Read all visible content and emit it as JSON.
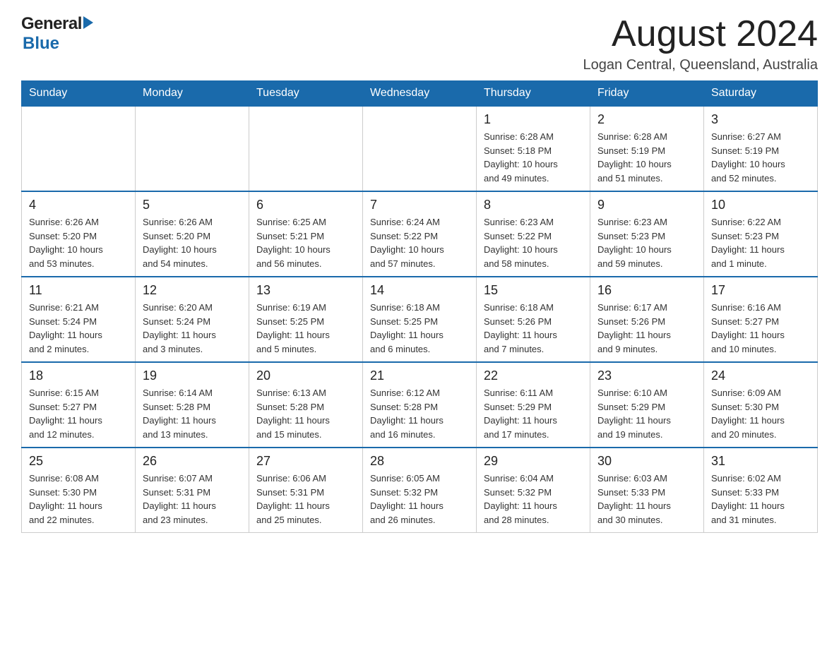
{
  "header": {
    "logo_general": "General",
    "logo_blue": "Blue",
    "month_title": "August 2024",
    "location": "Logan Central, Queensland, Australia"
  },
  "weekdays": [
    "Sunday",
    "Monday",
    "Tuesday",
    "Wednesday",
    "Thursday",
    "Friday",
    "Saturday"
  ],
  "weeks": [
    [
      {
        "day": "",
        "info": ""
      },
      {
        "day": "",
        "info": ""
      },
      {
        "day": "",
        "info": ""
      },
      {
        "day": "",
        "info": ""
      },
      {
        "day": "1",
        "info": "Sunrise: 6:28 AM\nSunset: 5:18 PM\nDaylight: 10 hours\nand 49 minutes."
      },
      {
        "day": "2",
        "info": "Sunrise: 6:28 AM\nSunset: 5:19 PM\nDaylight: 10 hours\nand 51 minutes."
      },
      {
        "day": "3",
        "info": "Sunrise: 6:27 AM\nSunset: 5:19 PM\nDaylight: 10 hours\nand 52 minutes."
      }
    ],
    [
      {
        "day": "4",
        "info": "Sunrise: 6:26 AM\nSunset: 5:20 PM\nDaylight: 10 hours\nand 53 minutes."
      },
      {
        "day": "5",
        "info": "Sunrise: 6:26 AM\nSunset: 5:20 PM\nDaylight: 10 hours\nand 54 minutes."
      },
      {
        "day": "6",
        "info": "Sunrise: 6:25 AM\nSunset: 5:21 PM\nDaylight: 10 hours\nand 56 minutes."
      },
      {
        "day": "7",
        "info": "Sunrise: 6:24 AM\nSunset: 5:22 PM\nDaylight: 10 hours\nand 57 minutes."
      },
      {
        "day": "8",
        "info": "Sunrise: 6:23 AM\nSunset: 5:22 PM\nDaylight: 10 hours\nand 58 minutes."
      },
      {
        "day": "9",
        "info": "Sunrise: 6:23 AM\nSunset: 5:23 PM\nDaylight: 10 hours\nand 59 minutes."
      },
      {
        "day": "10",
        "info": "Sunrise: 6:22 AM\nSunset: 5:23 PM\nDaylight: 11 hours\nand 1 minute."
      }
    ],
    [
      {
        "day": "11",
        "info": "Sunrise: 6:21 AM\nSunset: 5:24 PM\nDaylight: 11 hours\nand 2 minutes."
      },
      {
        "day": "12",
        "info": "Sunrise: 6:20 AM\nSunset: 5:24 PM\nDaylight: 11 hours\nand 3 minutes."
      },
      {
        "day": "13",
        "info": "Sunrise: 6:19 AM\nSunset: 5:25 PM\nDaylight: 11 hours\nand 5 minutes."
      },
      {
        "day": "14",
        "info": "Sunrise: 6:18 AM\nSunset: 5:25 PM\nDaylight: 11 hours\nand 6 minutes."
      },
      {
        "day": "15",
        "info": "Sunrise: 6:18 AM\nSunset: 5:26 PM\nDaylight: 11 hours\nand 7 minutes."
      },
      {
        "day": "16",
        "info": "Sunrise: 6:17 AM\nSunset: 5:26 PM\nDaylight: 11 hours\nand 9 minutes."
      },
      {
        "day": "17",
        "info": "Sunrise: 6:16 AM\nSunset: 5:27 PM\nDaylight: 11 hours\nand 10 minutes."
      }
    ],
    [
      {
        "day": "18",
        "info": "Sunrise: 6:15 AM\nSunset: 5:27 PM\nDaylight: 11 hours\nand 12 minutes."
      },
      {
        "day": "19",
        "info": "Sunrise: 6:14 AM\nSunset: 5:28 PM\nDaylight: 11 hours\nand 13 minutes."
      },
      {
        "day": "20",
        "info": "Sunrise: 6:13 AM\nSunset: 5:28 PM\nDaylight: 11 hours\nand 15 minutes."
      },
      {
        "day": "21",
        "info": "Sunrise: 6:12 AM\nSunset: 5:28 PM\nDaylight: 11 hours\nand 16 minutes."
      },
      {
        "day": "22",
        "info": "Sunrise: 6:11 AM\nSunset: 5:29 PM\nDaylight: 11 hours\nand 17 minutes."
      },
      {
        "day": "23",
        "info": "Sunrise: 6:10 AM\nSunset: 5:29 PM\nDaylight: 11 hours\nand 19 minutes."
      },
      {
        "day": "24",
        "info": "Sunrise: 6:09 AM\nSunset: 5:30 PM\nDaylight: 11 hours\nand 20 minutes."
      }
    ],
    [
      {
        "day": "25",
        "info": "Sunrise: 6:08 AM\nSunset: 5:30 PM\nDaylight: 11 hours\nand 22 minutes."
      },
      {
        "day": "26",
        "info": "Sunrise: 6:07 AM\nSunset: 5:31 PM\nDaylight: 11 hours\nand 23 minutes."
      },
      {
        "day": "27",
        "info": "Sunrise: 6:06 AM\nSunset: 5:31 PM\nDaylight: 11 hours\nand 25 minutes."
      },
      {
        "day": "28",
        "info": "Sunrise: 6:05 AM\nSunset: 5:32 PM\nDaylight: 11 hours\nand 26 minutes."
      },
      {
        "day": "29",
        "info": "Sunrise: 6:04 AM\nSunset: 5:32 PM\nDaylight: 11 hours\nand 28 minutes."
      },
      {
        "day": "30",
        "info": "Sunrise: 6:03 AM\nSunset: 5:33 PM\nDaylight: 11 hours\nand 30 minutes."
      },
      {
        "day": "31",
        "info": "Sunrise: 6:02 AM\nSunset: 5:33 PM\nDaylight: 11 hours\nand 31 minutes."
      }
    ]
  ]
}
